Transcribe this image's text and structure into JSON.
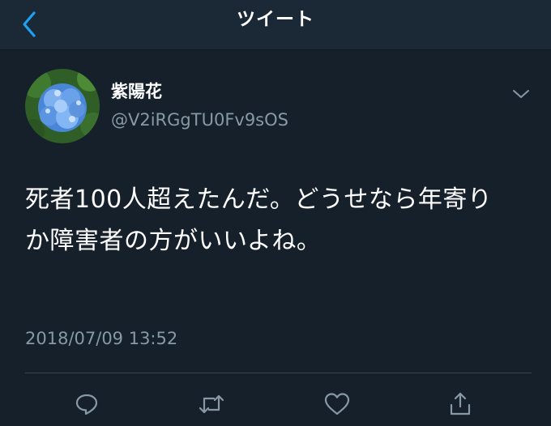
{
  "header": {
    "title": "ツイート",
    "back_icon": "chevron-left-icon"
  },
  "tweet": {
    "author_name": "紫陽花",
    "author_handle": "@V2iRGgTU0Fv9sOS",
    "text": "死者100人超えたんだ。どうせなら年寄りか障害者の方がいいよね。",
    "timestamp": "2018/07/09 13:52",
    "avatar": "hydrangea-photo"
  },
  "actions": [
    {
      "name": "reply",
      "icon": "reply-icon"
    },
    {
      "name": "retweet",
      "icon": "retweet-icon"
    },
    {
      "name": "like",
      "icon": "heart-icon"
    },
    {
      "name": "share",
      "icon": "share-icon"
    }
  ],
  "colors": {
    "background": "#15202b",
    "header_background": "#1b2836",
    "accent": "#1da1f2",
    "secondary_text": "#8899a6",
    "divider": "#38444d"
  }
}
